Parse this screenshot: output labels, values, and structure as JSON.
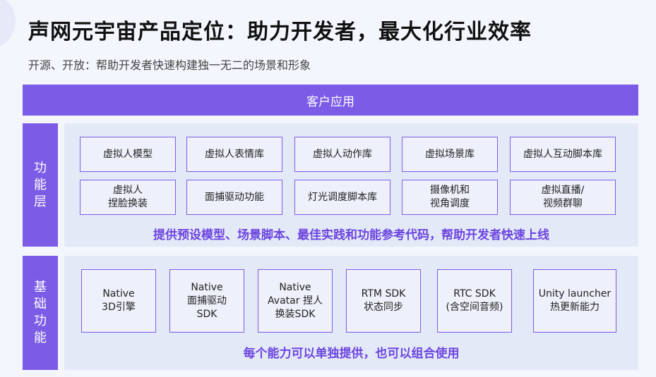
{
  "title": "声网元宇宙产品定位：助力开发者，最大化行业效率",
  "subtitle": "开源、开放：帮助开发者快速构建独一无二的场景和形象",
  "banner": "客户应用",
  "function_layer": {
    "label": [
      "功",
      "能",
      "层"
    ],
    "row1": [
      "虚拟人模型",
      "虚拟人表情库",
      "虚拟人动作库",
      "虚拟场景库",
      "虚拟人互动脚本库"
    ],
    "row2": [
      "虚拟人\n捏脸换装",
      "面捕驱动功能",
      "灯光调度脚本库",
      "摄像机和\n视角调度",
      "虚拟直播/\n视频群聊"
    ],
    "caption": "提供预设模型、场景脚本、最佳实践和功能参考代码，帮助开发者快速上线"
  },
  "base_layer": {
    "label": [
      "基",
      "础",
      "功",
      "能"
    ],
    "items": [
      "Native\n3D引擎",
      "Native\n面捕驱动\nSDK",
      "Native\nAvatar 捏人\n换装SDK",
      "RTM SDK\n状态同步",
      "RTC SDK\n(含空间音频)",
      "Unity launcher\n热更新能力"
    ],
    "caption": "每个能力可以单独提供，也可以组合使用"
  }
}
